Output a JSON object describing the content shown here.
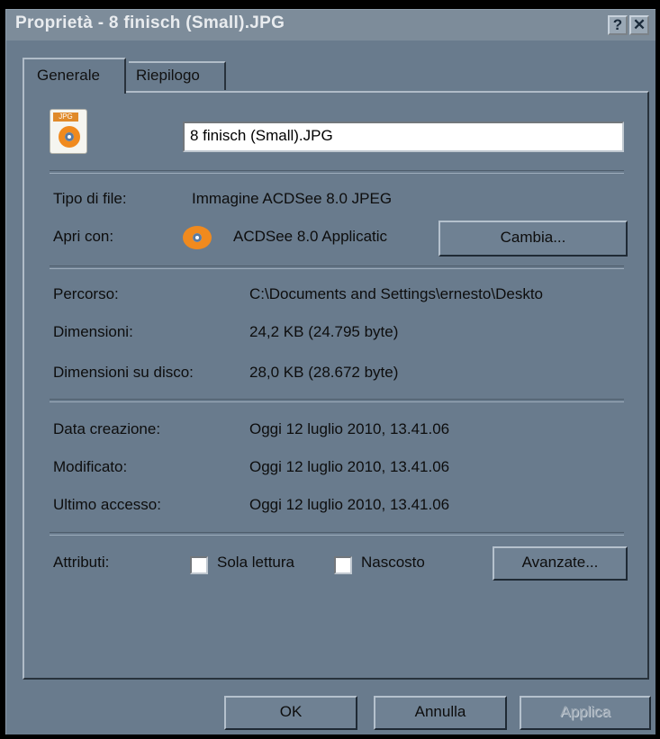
{
  "window": {
    "title": "Proprietà - 8 finisch (Small).JPG",
    "help_glyph": "?",
    "close_glyph": "✕"
  },
  "tabs": [
    {
      "label": "Generale",
      "active": true
    },
    {
      "label": "Riepilogo",
      "active": false
    }
  ],
  "file": {
    "icon_tag": "JPG",
    "name_value": "8 finisch (Small).JPG"
  },
  "info": {
    "type_label": "Tipo di file:",
    "type_value": "Immagine ACDSee 8.0 JPEG",
    "open_label": "Apri con:",
    "open_value": "ACDSee 8.0 Applicatic",
    "change_button": "Cambia...",
    "path_label": "Percorso:",
    "path_value": "C:\\Documents and Settings\\ernesto\\Deskto",
    "size_label": "Dimensioni:",
    "size_value": "24,2 KB (24.795 byte)",
    "disk_label": "Dimensioni su disco:",
    "disk_value": "28,0 KB (28.672 byte)",
    "created_label": "Data creazione:",
    "created_value": "Oggi 12 luglio 2010, 13.41.06",
    "modified_label": "Modificato:",
    "modified_value": "Oggi 12 luglio 2010, 13.41.06",
    "accessed_label": "Ultimo accesso:",
    "accessed_value": "Oggi 12 luglio 2010, 13.41.06"
  },
  "attributes": {
    "label": "Attributi:",
    "readonly_label": "Sola lettura",
    "readonly_checked": false,
    "hidden_label": "Nascosto",
    "hidden_checked": false,
    "advanced_button": "Avanzate..."
  },
  "footer": {
    "ok": "OK",
    "cancel": "Annulla",
    "apply": "Applica"
  }
}
